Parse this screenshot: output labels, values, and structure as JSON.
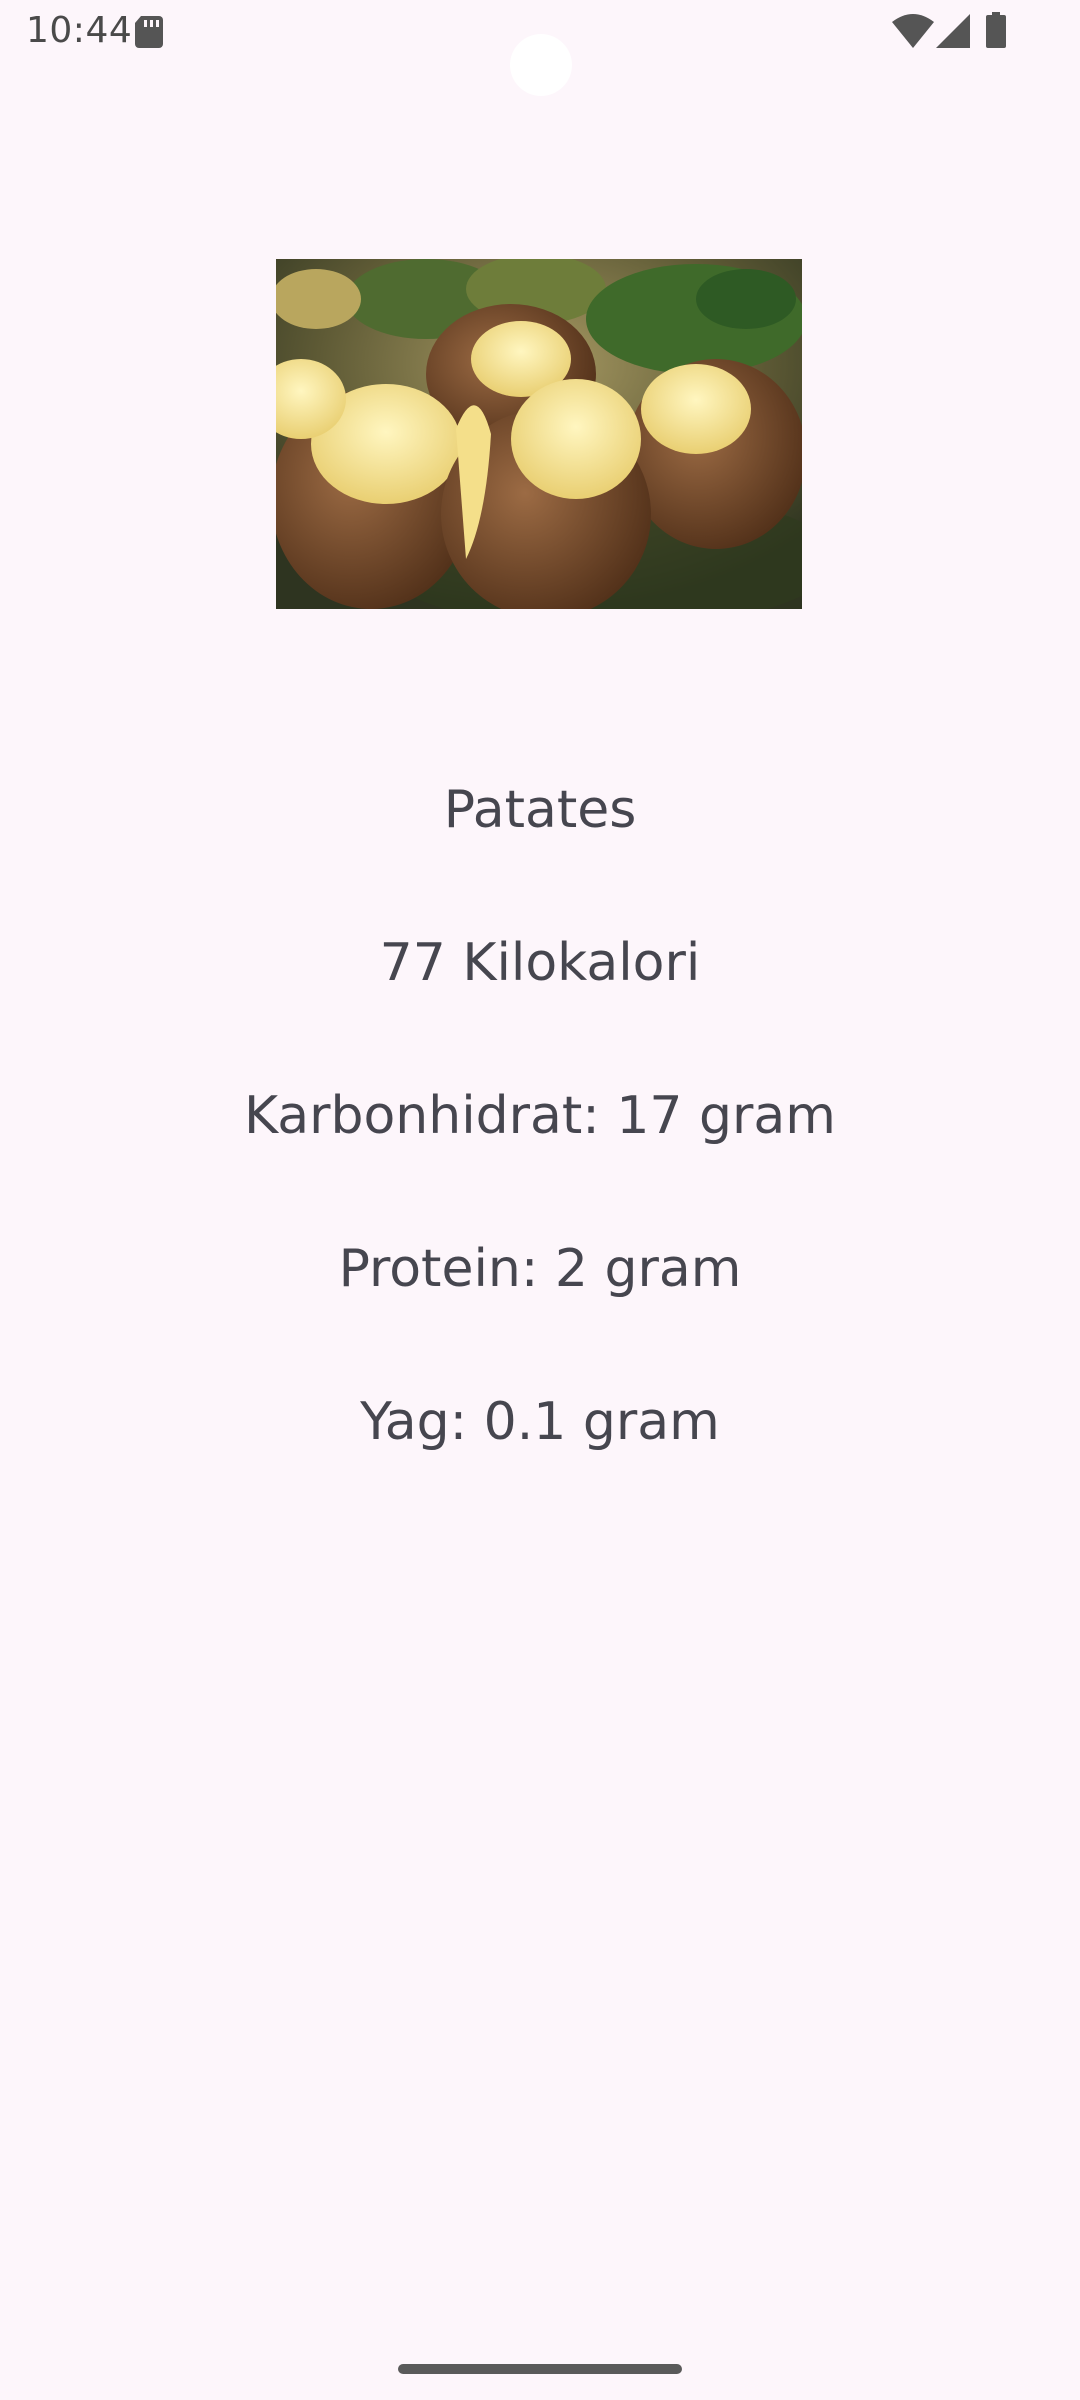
{
  "status_bar": {
    "time": "10:44",
    "icons": [
      "sd-card-icon",
      "wifi-icon",
      "signal-icon",
      "battery-icon"
    ]
  },
  "food": {
    "image_description": "baked-potatoes-photo",
    "name": "Patates",
    "calories": "77 Kilokalori",
    "carbs": "Karbonhidrat: 17 gram",
    "protein": "Protein: 2 gram",
    "fat": "Yag: 0.1 gram"
  },
  "colors": {
    "background": "#fdf6fb",
    "text": "#46464f"
  }
}
